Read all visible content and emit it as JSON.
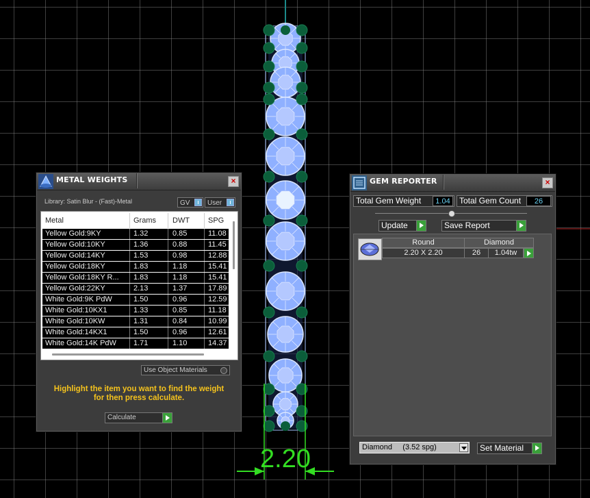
{
  "viewport": {
    "dimension_label": "2.20"
  },
  "metal_weights": {
    "title": "METAL WEIGHTS",
    "library_label": "Library: Satin Blur - (Fast)-Metal",
    "gv_label": "GV",
    "user_label": "User",
    "columns": [
      "Metal",
      "Grams",
      "DWT",
      "SPG"
    ],
    "rows": [
      {
        "metal": "Yellow Gold:9KY",
        "grams": "1.32",
        "dwt": "0.85",
        "spg": "11.08"
      },
      {
        "metal": "Yellow Gold:10KY",
        "grams": "1.36",
        "dwt": "0.88",
        "spg": "11.45"
      },
      {
        "metal": "Yellow Gold:14KY",
        "grams": "1.53",
        "dwt": "0.98",
        "spg": "12.88"
      },
      {
        "metal": "Yellow Gold:18KY",
        "grams": "1.83",
        "dwt": "1.18",
        "spg": "15.41"
      },
      {
        "metal": "Yellow Gold:18KY R...",
        "grams": "1.83",
        "dwt": "1.18",
        "spg": "15.41"
      },
      {
        "metal": "Yellow Gold:22KY",
        "grams": "2.13",
        "dwt": "1.37",
        "spg": "17.89"
      },
      {
        "metal": "White Gold:9K PdW",
        "grams": "1.50",
        "dwt": "0.96",
        "spg": "12.59"
      },
      {
        "metal": "White Gold:10KX1",
        "grams": "1.33",
        "dwt": "0.85",
        "spg": "11.18"
      },
      {
        "metal": "White Gold:10KW",
        "grams": "1.31",
        "dwt": "0.84",
        "spg": "10.99"
      },
      {
        "metal": "White Gold:14KX1",
        "grams": "1.50",
        "dwt": "0.96",
        "spg": "12.61"
      },
      {
        "metal": "White Gold:14K PdW",
        "grams": "1.71",
        "dwt": "1.10",
        "spg": "14.37"
      }
    ],
    "use_object_materials_label": "Use Object Materials",
    "help_text_line1": "Highlight the item you want to find the weight",
    "help_text_line2": "for then press calculate.",
    "calculate_label": "Calculate"
  },
  "gem_reporter": {
    "title": "GEM REPORTER",
    "total_gem_weight_label": "Total Gem Weight",
    "total_gem_weight_value": "1.04",
    "total_gem_count_label": "Total Gem Count",
    "total_gem_count_value": "26",
    "update_label": "Update",
    "save_report_label": "Save Report",
    "gem": {
      "shape": "Round",
      "material": "Diamond",
      "size": "2.20 X 2.20",
      "count": "26",
      "weight": "1.04tw"
    },
    "material_select": "Diamond     (3.52 spg)",
    "set_material_label": "Set Material"
  },
  "colors": {
    "gem_blue": "#8fb0ff",
    "prong_green": "#0b5e3a",
    "dimension_green": "#33dd22",
    "help_yellow": "#f4c21d",
    "value_cyan": "#6ad0f0"
  }
}
